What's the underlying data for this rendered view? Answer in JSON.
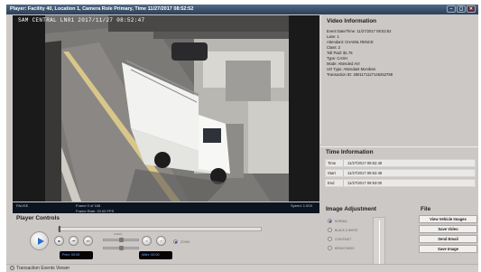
{
  "window": {
    "title": "Player: Facility 40, Location 1, Camera Role Primary, Time 11/27/2017 08:52:52",
    "buttons": [
      "min",
      "max",
      "close"
    ]
  },
  "video": {
    "overlay_text": "SAM CENTRAL LN01  2017/11/27 08:52:47"
  },
  "status": {
    "state": "PAUSE",
    "frame": "Frame 0 of 168",
    "frame_rate": "Frame Rate: 20.00 FPS",
    "speed": "Speed: 1.00X"
  },
  "video_info": {
    "title": "Video Information",
    "lines": [
      "Event Date/Time:  11/27/2017 08:52:52",
      "Lane:  1",
      "Attendant:  CHAMIL RENCE",
      "Class:  2",
      "Toll Paid:  $1.75",
      "Type:  CASH",
      "Mode:  Attended AVI",
      "UO Type:  Attendant Moniless",
      "Transaction ID:  4801171127145252788"
    ]
  },
  "time_info": {
    "title": "Time Information",
    "rows": [
      {
        "label": "Time",
        "value": "11/27/2017 08:52:48"
      },
      {
        "label": "Start",
        "value": "11/27/2017 08:52:48"
      },
      {
        "label": "End",
        "value": "11/27/2017 08:53:00"
      }
    ]
  },
  "image_adjustment": {
    "title": "Image Adjustment",
    "options": [
      "NORMAL",
      "BLACK & WHITE",
      "CONTRAST",
      "BRIGHTNESS"
    ],
    "selected": "NORMAL"
  },
  "file": {
    "title": "File",
    "buttons": [
      "View Vehicle Images",
      "Save Video",
      "Send Email",
      "Save Image"
    ]
  },
  "player_controls": {
    "title": "Player Controls",
    "speed_label": "SPEED",
    "zoom_label": "ZOOM",
    "prev_label": "Prev: 00:00",
    "after_label": "After: 00:00"
  },
  "bottom": {
    "label": "Transaction Events Viewer"
  },
  "colors": {
    "titlebar": "#2b3f57",
    "panel_bg": "#ccc8c6",
    "accent": "#2b6fd0"
  }
}
